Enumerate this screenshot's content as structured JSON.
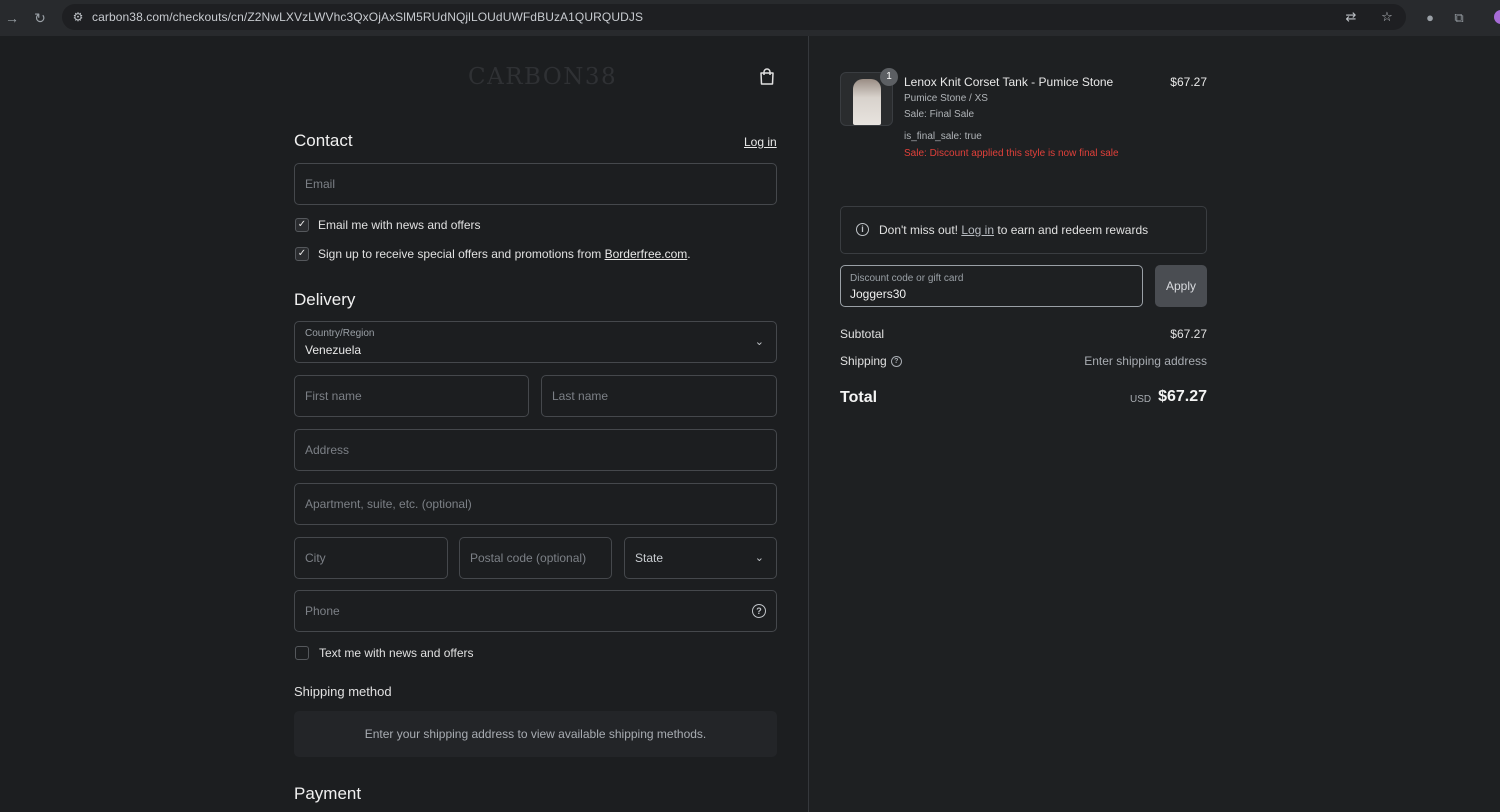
{
  "browser": {
    "url": "carbon38.com/checkouts/cn/Z2NwLXVzLWVhc3QxOjAxSlM5RUdNQjlLOUdUWFdBUzA1QURQUDJS"
  },
  "brand": {
    "logo": "CARBON38"
  },
  "contact": {
    "title": "Contact",
    "login_label": "Log in",
    "email_placeholder": "Email",
    "news_checkbox_label": "Email me with news and offers",
    "promo_prefix": "Sign up to receive special offers and promotions from ",
    "promo_link": "Borderfree.com",
    "promo_suffix": "."
  },
  "delivery": {
    "title": "Delivery",
    "country_label": "Country/Region",
    "country_value": "Venezuela",
    "first_name_placeholder": "First name",
    "last_name_placeholder": "Last name",
    "address_placeholder": "Address",
    "apartment_placeholder": "Apartment, suite, etc. (optional)",
    "city_placeholder": "City",
    "postal_placeholder": "Postal code (optional)",
    "state_placeholder": "State",
    "phone_placeholder": "Phone",
    "text_checkbox_label": "Text me with news and offers"
  },
  "shipping_method": {
    "title": "Shipping method",
    "message": "Enter your shipping address to view available shipping methods."
  },
  "payment": {
    "title": "Payment"
  },
  "order": {
    "quantity": "1",
    "product_name": "Lenox Knit Corset Tank - Pumice Stone",
    "price": "$67.27",
    "variant": "Pumice Stone / XS",
    "sale": "Sale: Final Sale",
    "final_sale": "is_final_sale: true",
    "discount_note": "Sale: Discount applied this style is now final sale"
  },
  "rewards": {
    "prefix": "Don't miss out! ",
    "link": "Log in",
    "suffix": " to earn and redeem rewards"
  },
  "discount": {
    "label": "Discount code or gift card",
    "value": "Joggers30",
    "apply_label": "Apply"
  },
  "summary": {
    "subtotal_label": "Subtotal",
    "subtotal_value": "$67.27",
    "shipping_label": "Shipping",
    "shipping_value": "Enter shipping address",
    "total_label": "Total",
    "currency": "USD",
    "total_value": "$67.27"
  }
}
